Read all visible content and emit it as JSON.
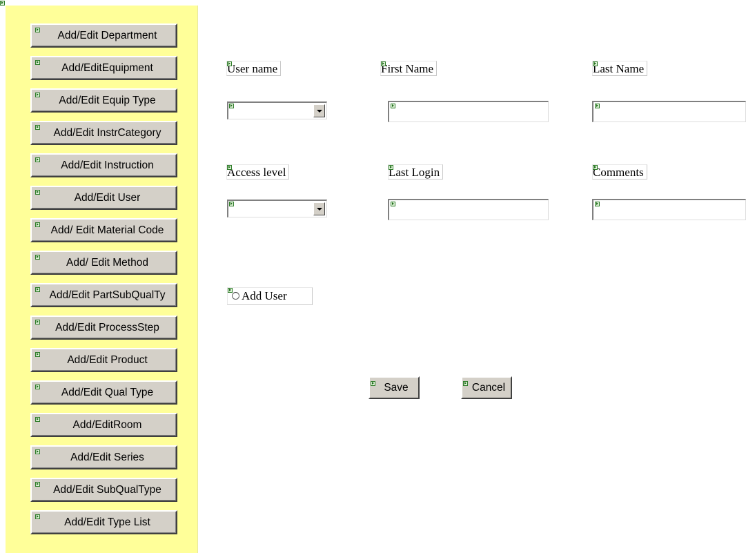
{
  "sidebar": {
    "background": "#ffff99",
    "items": [
      {
        "label": "Add/Edit Department"
      },
      {
        "label": "Add/EditEquipment"
      },
      {
        "label": "Add/Edit Equip Type"
      },
      {
        "label": "Add/Edit InstrCategory"
      },
      {
        "label": "Add/Edit Instruction"
      },
      {
        "label": "Add/Edit User"
      },
      {
        "label": "Add/ Edit Material Code"
      },
      {
        "label": "Add/ Edit Method"
      },
      {
        "label": "Add/Edit PartSubQualTy"
      },
      {
        "label": "Add/Edit ProcessStep"
      },
      {
        "label": "Add/Edit Product"
      },
      {
        "label": "Add/Edit Qual Type"
      },
      {
        "label": "Add/EditRoom"
      },
      {
        "label": "Add/Edit Series"
      },
      {
        "label": "Add/Edit SubQualType"
      },
      {
        "label": "Add/Edit Type List"
      }
    ]
  },
  "form": {
    "labels": {
      "user_name": "User name",
      "first_name": "First Name",
      "last_name": "Last Name",
      "access_level": "Access level",
      "last_login": "Last Login",
      "comments": "Comments"
    },
    "values": {
      "user_name": "",
      "first_name": "",
      "last_name": "",
      "access_level": "",
      "last_login": "",
      "comments": ""
    },
    "radio": {
      "label": "Add User",
      "checked": false
    },
    "buttons": {
      "save": "Save",
      "cancel": "Cancel"
    }
  },
  "colors": {
    "button_face": "#d4d0c8",
    "marker_green": "#2f7d2a"
  },
  "icons": {
    "marker": "design-marker-icon",
    "dropdown": "chevron-down-icon",
    "radio": "radio-icon"
  }
}
